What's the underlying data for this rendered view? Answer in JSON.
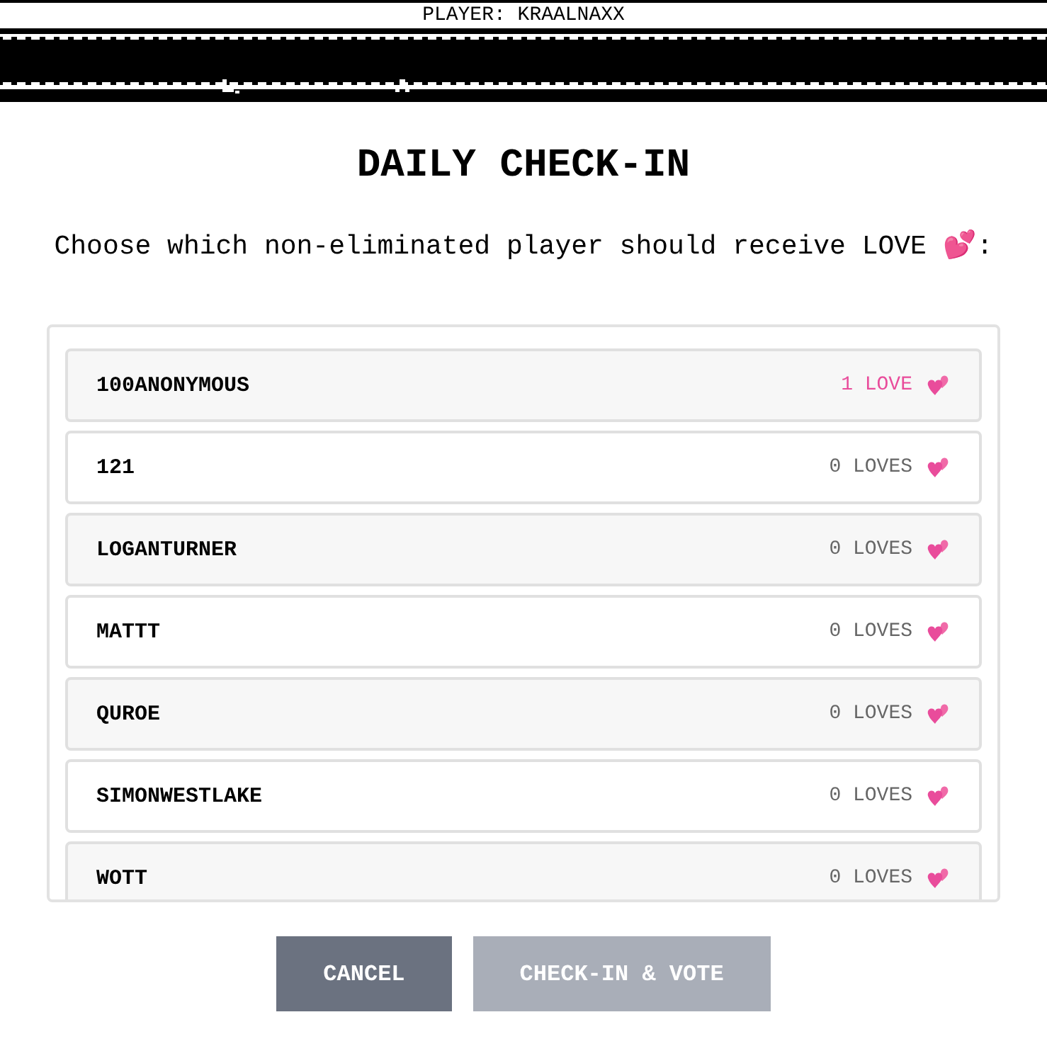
{
  "header": {
    "player_label": "PLAYER: KRAALNAXX"
  },
  "title": "DAILY CHECK-IN",
  "prompt": "Choose which non-eliminated player should receive LOVE 💕:",
  "players": [
    {
      "name": "100ANONYMOUS",
      "loves": "1 LOVE",
      "loved": true
    },
    {
      "name": "121",
      "loves": "0 LOVES",
      "loved": false
    },
    {
      "name": "LOGANTURNER",
      "loves": "0 LOVES",
      "loved": false
    },
    {
      "name": "MATTT",
      "loves": "0 LOVES",
      "loved": false
    },
    {
      "name": "QUROE",
      "loves": "0 LOVES",
      "loved": false
    },
    {
      "name": "SIMONWESTLAKE",
      "loves": "0 LOVES",
      "loved": false
    },
    {
      "name": "WOTT",
      "loves": "0 LOVES",
      "loved": false
    }
  ],
  "buttons": [
    {
      "label": "CANCEL",
      "disabled": false
    },
    {
      "label": "CHECK-IN & VOTE",
      "disabled": true
    }
  ]
}
